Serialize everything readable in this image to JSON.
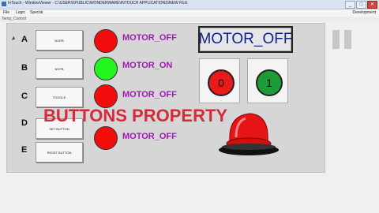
{
  "window": {
    "title": "InTouch - WindowViewer - C:\\USERS\\PUBLIC\\WONDERWARE\\INTOUCH APPLICATIONS\\NEW FILE",
    "minimize": "_",
    "maximize": "□",
    "close": "✕"
  },
  "menu": {
    "file": "File",
    "logic": "Logic",
    "special": "Special",
    "mode": "Development"
  },
  "toolstrip": {
    "label": "Temp_Control"
  },
  "rows": [
    {
      "letter": "A",
      "button": "NOPB",
      "lamp_color": "#f20c0c",
      "status": "MOTOR_OFF"
    },
    {
      "letter": "B",
      "button": "NCPB",
      "lamp_color": "#23f51e",
      "status": "MOTOR_ON"
    },
    {
      "letter": "C",
      "button": "TOGGLE",
      "lamp_color": "#f20c0c",
      "status": "MOTOR_OFF"
    },
    {
      "letter": "D",
      "button": "SET BUTTON",
      "lamp_color": "#f20c0c",
      "status": ""
    },
    {
      "letter": "E",
      "button": "RESET BUTTON",
      "lamp_color": "#f20c0c",
      "status": "MOTOR_OFF"
    }
  ],
  "display": {
    "value": "MOTOR_OFF"
  },
  "controls": {
    "off_label": "0",
    "on_label": "1"
  },
  "caption": "BUTTONS PROPERTY",
  "icons": {
    "beacon": "beacon-icon",
    "pause": "pause-icon",
    "cursor": "cursor-icon"
  },
  "colors": {
    "status_text": "#a01ab5",
    "display_text": "#10228e",
    "caption": "#d42a3a",
    "beacon": "#e61414"
  }
}
